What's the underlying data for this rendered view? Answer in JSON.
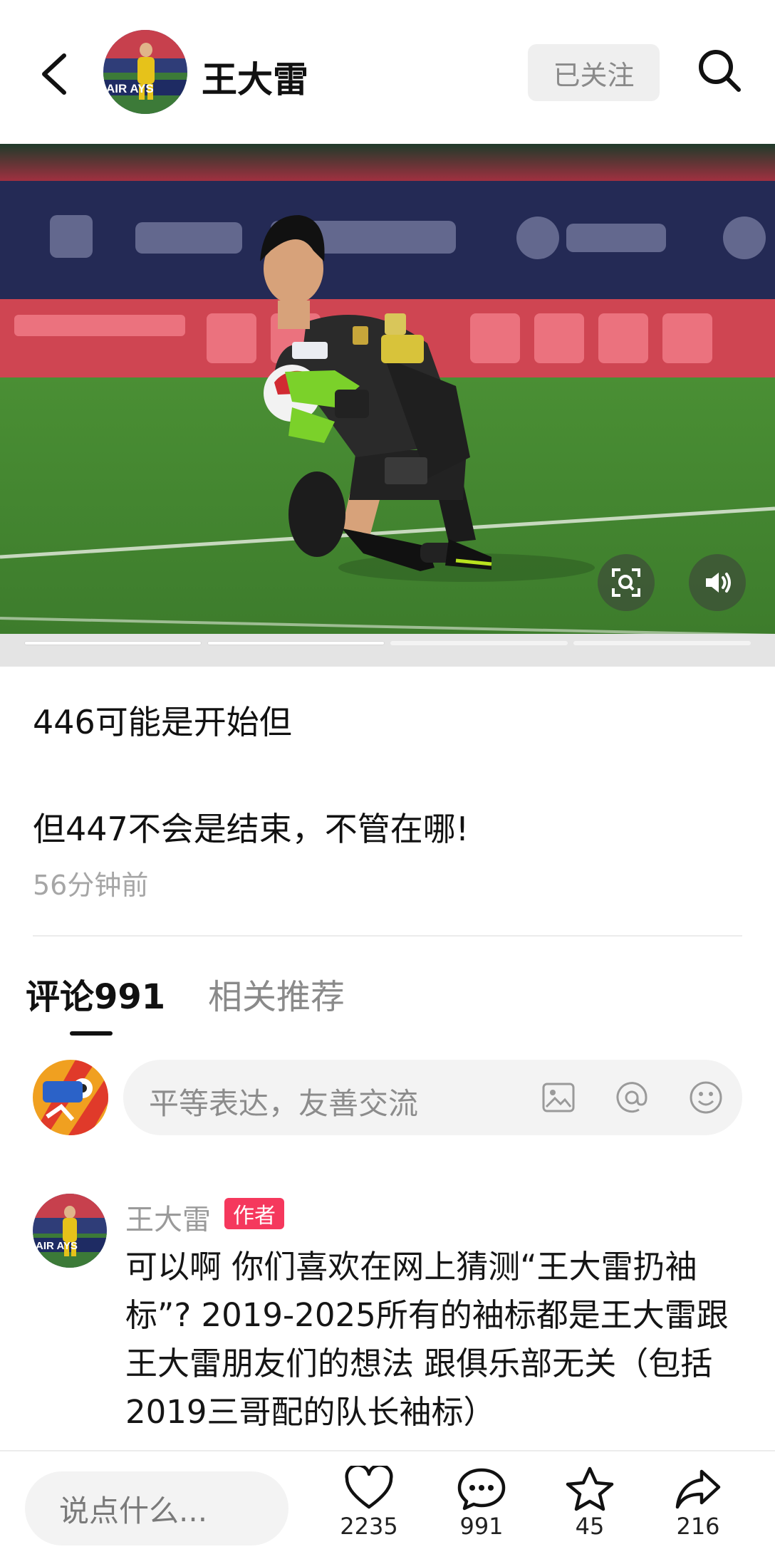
{
  "header": {
    "author_name": "王大雷",
    "follow_label": "已关注"
  },
  "post": {
    "line1": "446可能是开始但",
    "line2": "但447不会是结束，不管在哪!",
    "time": "56分钟前"
  },
  "tabs": {
    "comments": "评论991",
    "related": "相关推荐"
  },
  "comment_input": {
    "placeholder": "平等表达，友善交流"
  },
  "comments": [
    {
      "user": "王大雷",
      "badge": "作者",
      "text": "可以啊 你们喜欢在网上猜测“王大雷扔袖标”? 2019-2025所有的袖标都是王大雷跟王大雷朋友们的想法 跟俱乐部无关（包括2019三哥配的队长袖标）"
    }
  ],
  "bottom_bar": {
    "say_placeholder": "说点什么...",
    "likes": "2235",
    "comments": "991",
    "favorites": "45",
    "shares": "216"
  },
  "media": {
    "slides_total": 4,
    "slide_current": 2
  },
  "colors": {
    "badge": "#f5385d",
    "pitch": "#3f8a2f",
    "banner": "#242a55"
  },
  "icons": [
    "back-arrow-icon",
    "search-icon",
    "scan-icon",
    "sound-icon",
    "image-icon",
    "at-icon",
    "emoji-icon",
    "heart-icon",
    "comment-icon",
    "star-icon",
    "share-icon"
  ]
}
